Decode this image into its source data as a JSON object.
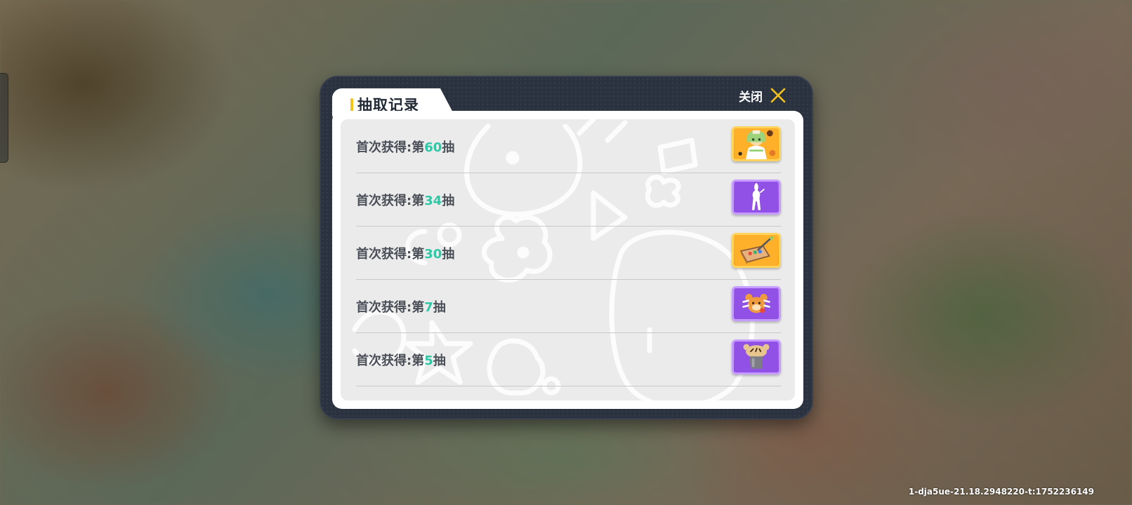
{
  "dialog": {
    "title": "抽取记录",
    "close_label": "关闭"
  },
  "records": [
    {
      "prefix": "首次获得:第",
      "number": "60",
      "suffix": "抽",
      "item_icon": "character-portrait-icon",
      "rarity_color": "#f7a21a"
    },
    {
      "prefix": "首次获得:第",
      "number": "34",
      "suffix": "抽",
      "item_icon": "character-silhouette-icon",
      "rarity_color": "#9151e6"
    },
    {
      "prefix": "首次获得:第",
      "number": "30",
      "suffix": "抽",
      "item_icon": "paint-box-icon",
      "rarity_color": "#f7a21a"
    },
    {
      "prefix": "首次获得:第",
      "number": "7",
      "suffix": "抽",
      "item_icon": "bear-emote-icon",
      "rarity_color": "#9151e6"
    },
    {
      "prefix": "首次获得:第",
      "number": "5",
      "suffix": "抽",
      "item_icon": "bear-cup-icon",
      "rarity_color": "#9151e6"
    }
  ],
  "footer": {
    "build_id": "1-dja5ue-21.18.2948220-t:1752236149"
  },
  "colors": {
    "accent_yellow": "#f5c31a",
    "number_green": "#2fc7a5",
    "dialog_dark": "#2a3240"
  }
}
